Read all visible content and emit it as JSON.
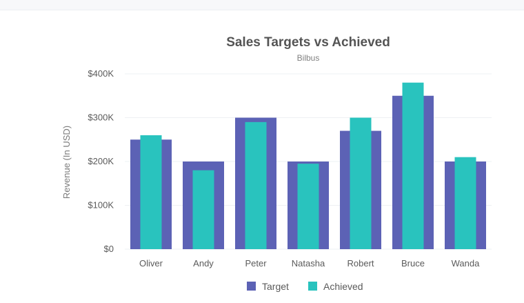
{
  "colors": {
    "target": "#5c62b5",
    "achieved": "#29c3be",
    "grid": "#eef0f3",
    "title": "#545454",
    "subtitle": "#808080",
    "axis_text": "#5a5a5a",
    "ylabel": "#7a7a7a"
  },
  "chart_data": {
    "type": "bar",
    "title": "Sales Targets vs Achieved",
    "subtitle": "Bilbus",
    "xlabel": "",
    "ylabel": "Revenue (In USD)",
    "ylim": [
      0,
      400000
    ],
    "yticks": [
      0,
      100000,
      200000,
      300000,
      400000
    ],
    "ytick_labels": [
      "$0",
      "$100K",
      "$200K",
      "$300K",
      "$400K"
    ],
    "grid": true,
    "legend_position": "bottom",
    "categories": [
      "Oliver",
      "Andy",
      "Peter",
      "Natasha",
      "Robert",
      "Bruce",
      "Wanda"
    ],
    "series": [
      {
        "name": "Target",
        "values": [
          250000,
          200000,
          300000,
          200000,
          270000,
          350000,
          200000
        ]
      },
      {
        "name": "Achieved",
        "values": [
          260000,
          180000,
          290000,
          195000,
          300000,
          380000,
          210000
        ]
      }
    ]
  }
}
